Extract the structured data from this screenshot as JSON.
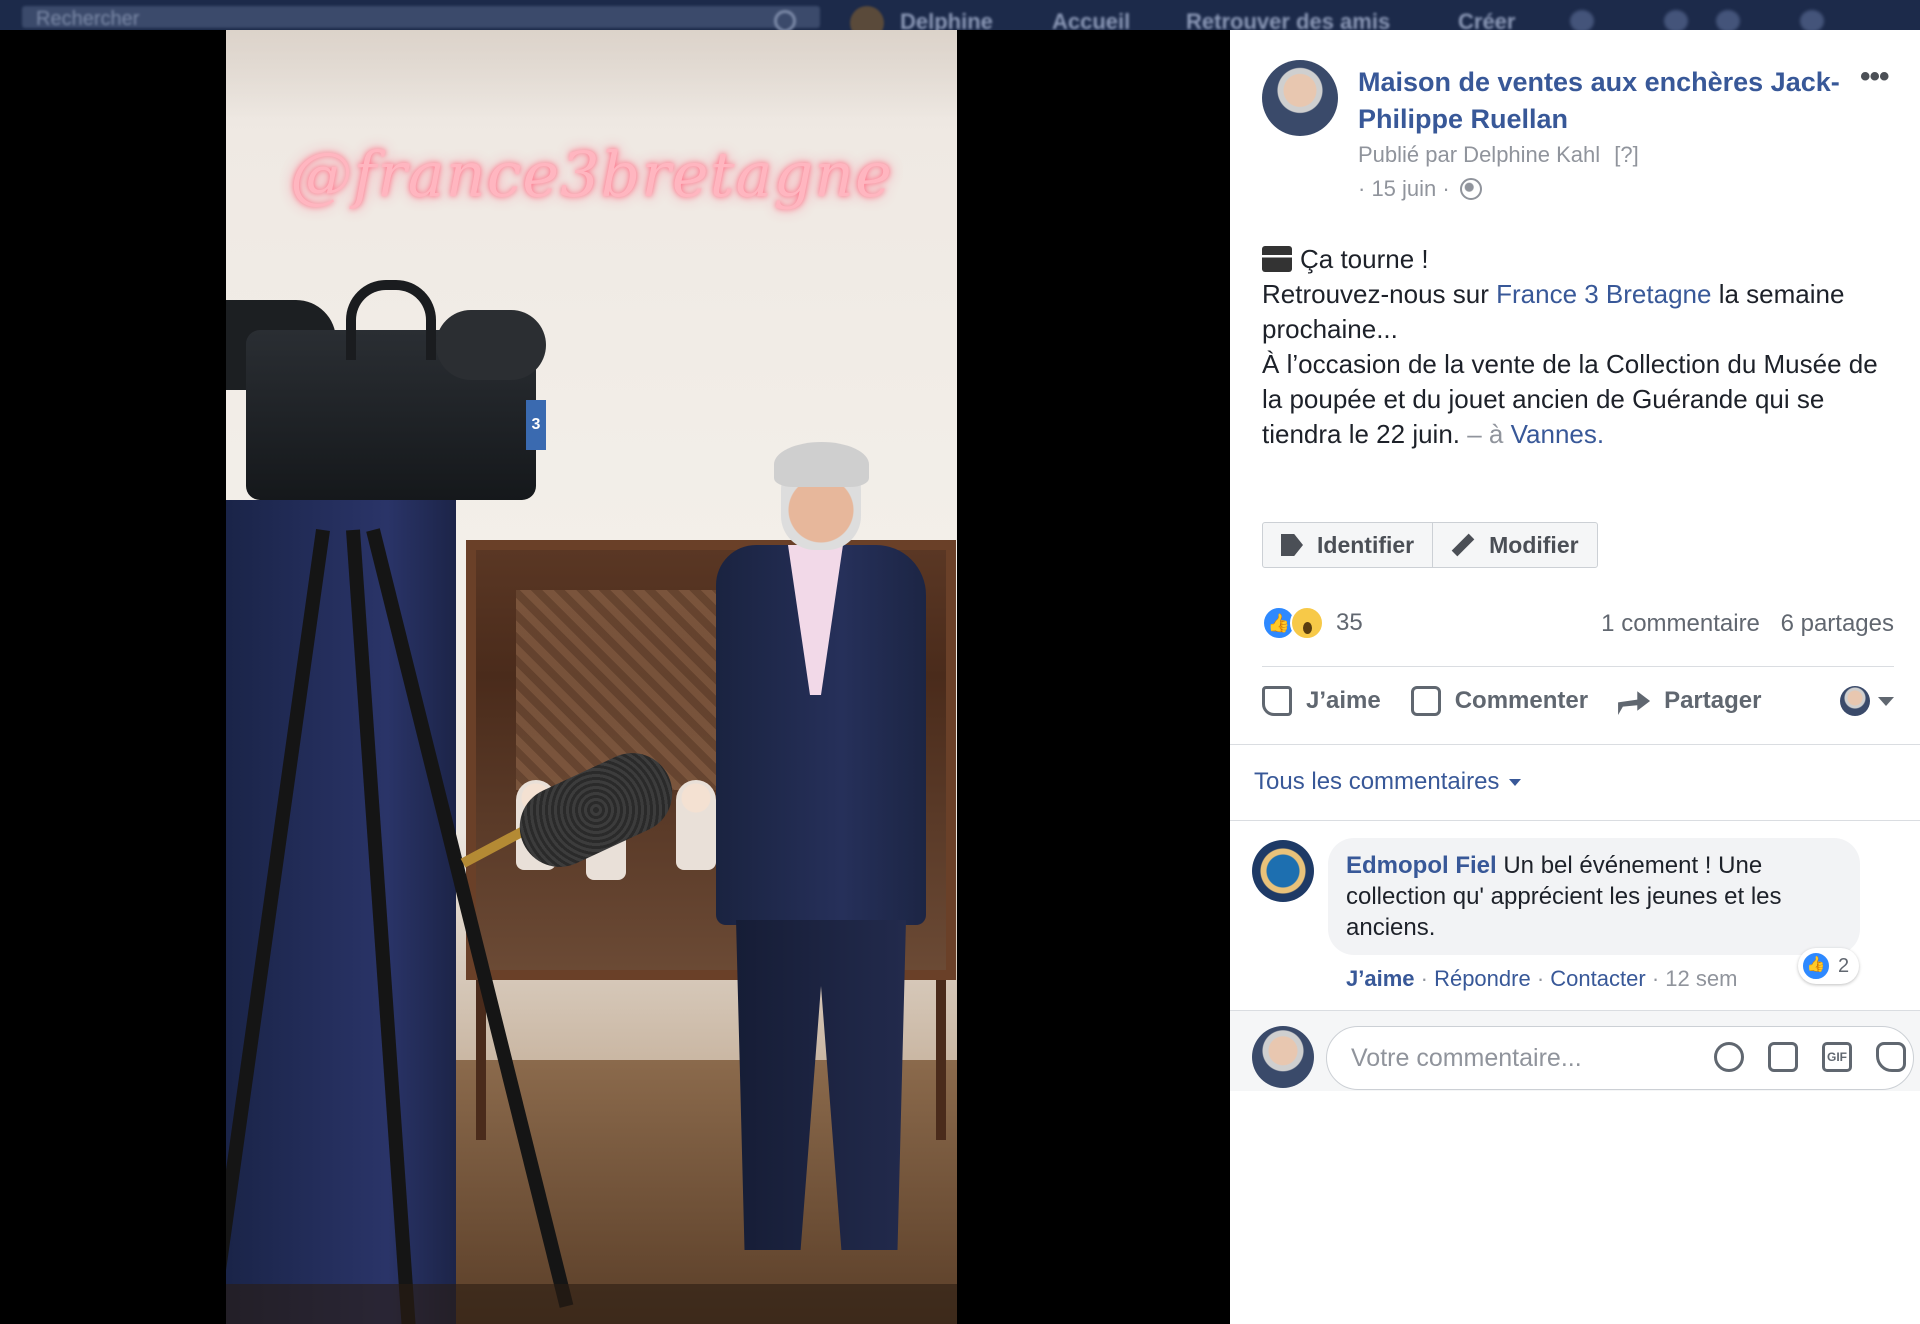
{
  "topbar": {
    "search_placeholder": "Rechercher",
    "nav": [
      "Delphine",
      "Accueil",
      "Retrouver des amis",
      "Créer"
    ]
  },
  "photo": {
    "neon_text": "@france3bretagne",
    "camera_badge": "3"
  },
  "post": {
    "page_name": "Maison de ventes aux enchères Jack-Philippe Ruellan",
    "more_label": "•••",
    "published_by": "Publié par Delphine Kahl",
    "published_help": "[?]",
    "date": "· 15 juin ·",
    "body": {
      "line1": "Ça tourne !",
      "line2_pre": "Retrouvez-nous sur ",
      "line2_link": "France 3 Bretagne",
      "line2_post": " la semaine prochaine...",
      "line3": "À l’occasion de la vente de la Collection du Musée de la poupée et du jouet ancien de Guérande qui se tiendra le 22 juin. ",
      "location_sep": "– à ",
      "location": "Vannes."
    },
    "buttons": {
      "tag": "Identifier",
      "edit": "Modifier"
    },
    "reactions_count": "35",
    "comments_count": "1 commentaire",
    "shares_count": "6 partages",
    "actions": {
      "like": "J’aime",
      "comment": "Commenter",
      "share": "Partager"
    }
  },
  "comments": {
    "filter_label": "Tous les commentaires",
    "items": [
      {
        "author": "Edmopol Fiel",
        "text": " Un bel événement ! Une collection qu' apprécient les jeunes et les anciens.",
        "likes": "2",
        "like_label": "J’aime",
        "reply_label": "Répondre",
        "contact_label": "Contacter",
        "time": "12 sem"
      }
    ],
    "composer_placeholder": "Votre commentaire...",
    "gif_label": "GIF"
  },
  "colors": {
    "link": "#385898",
    "like_blue": "#2e89ff",
    "neon_pink": "#ffb6c0"
  }
}
